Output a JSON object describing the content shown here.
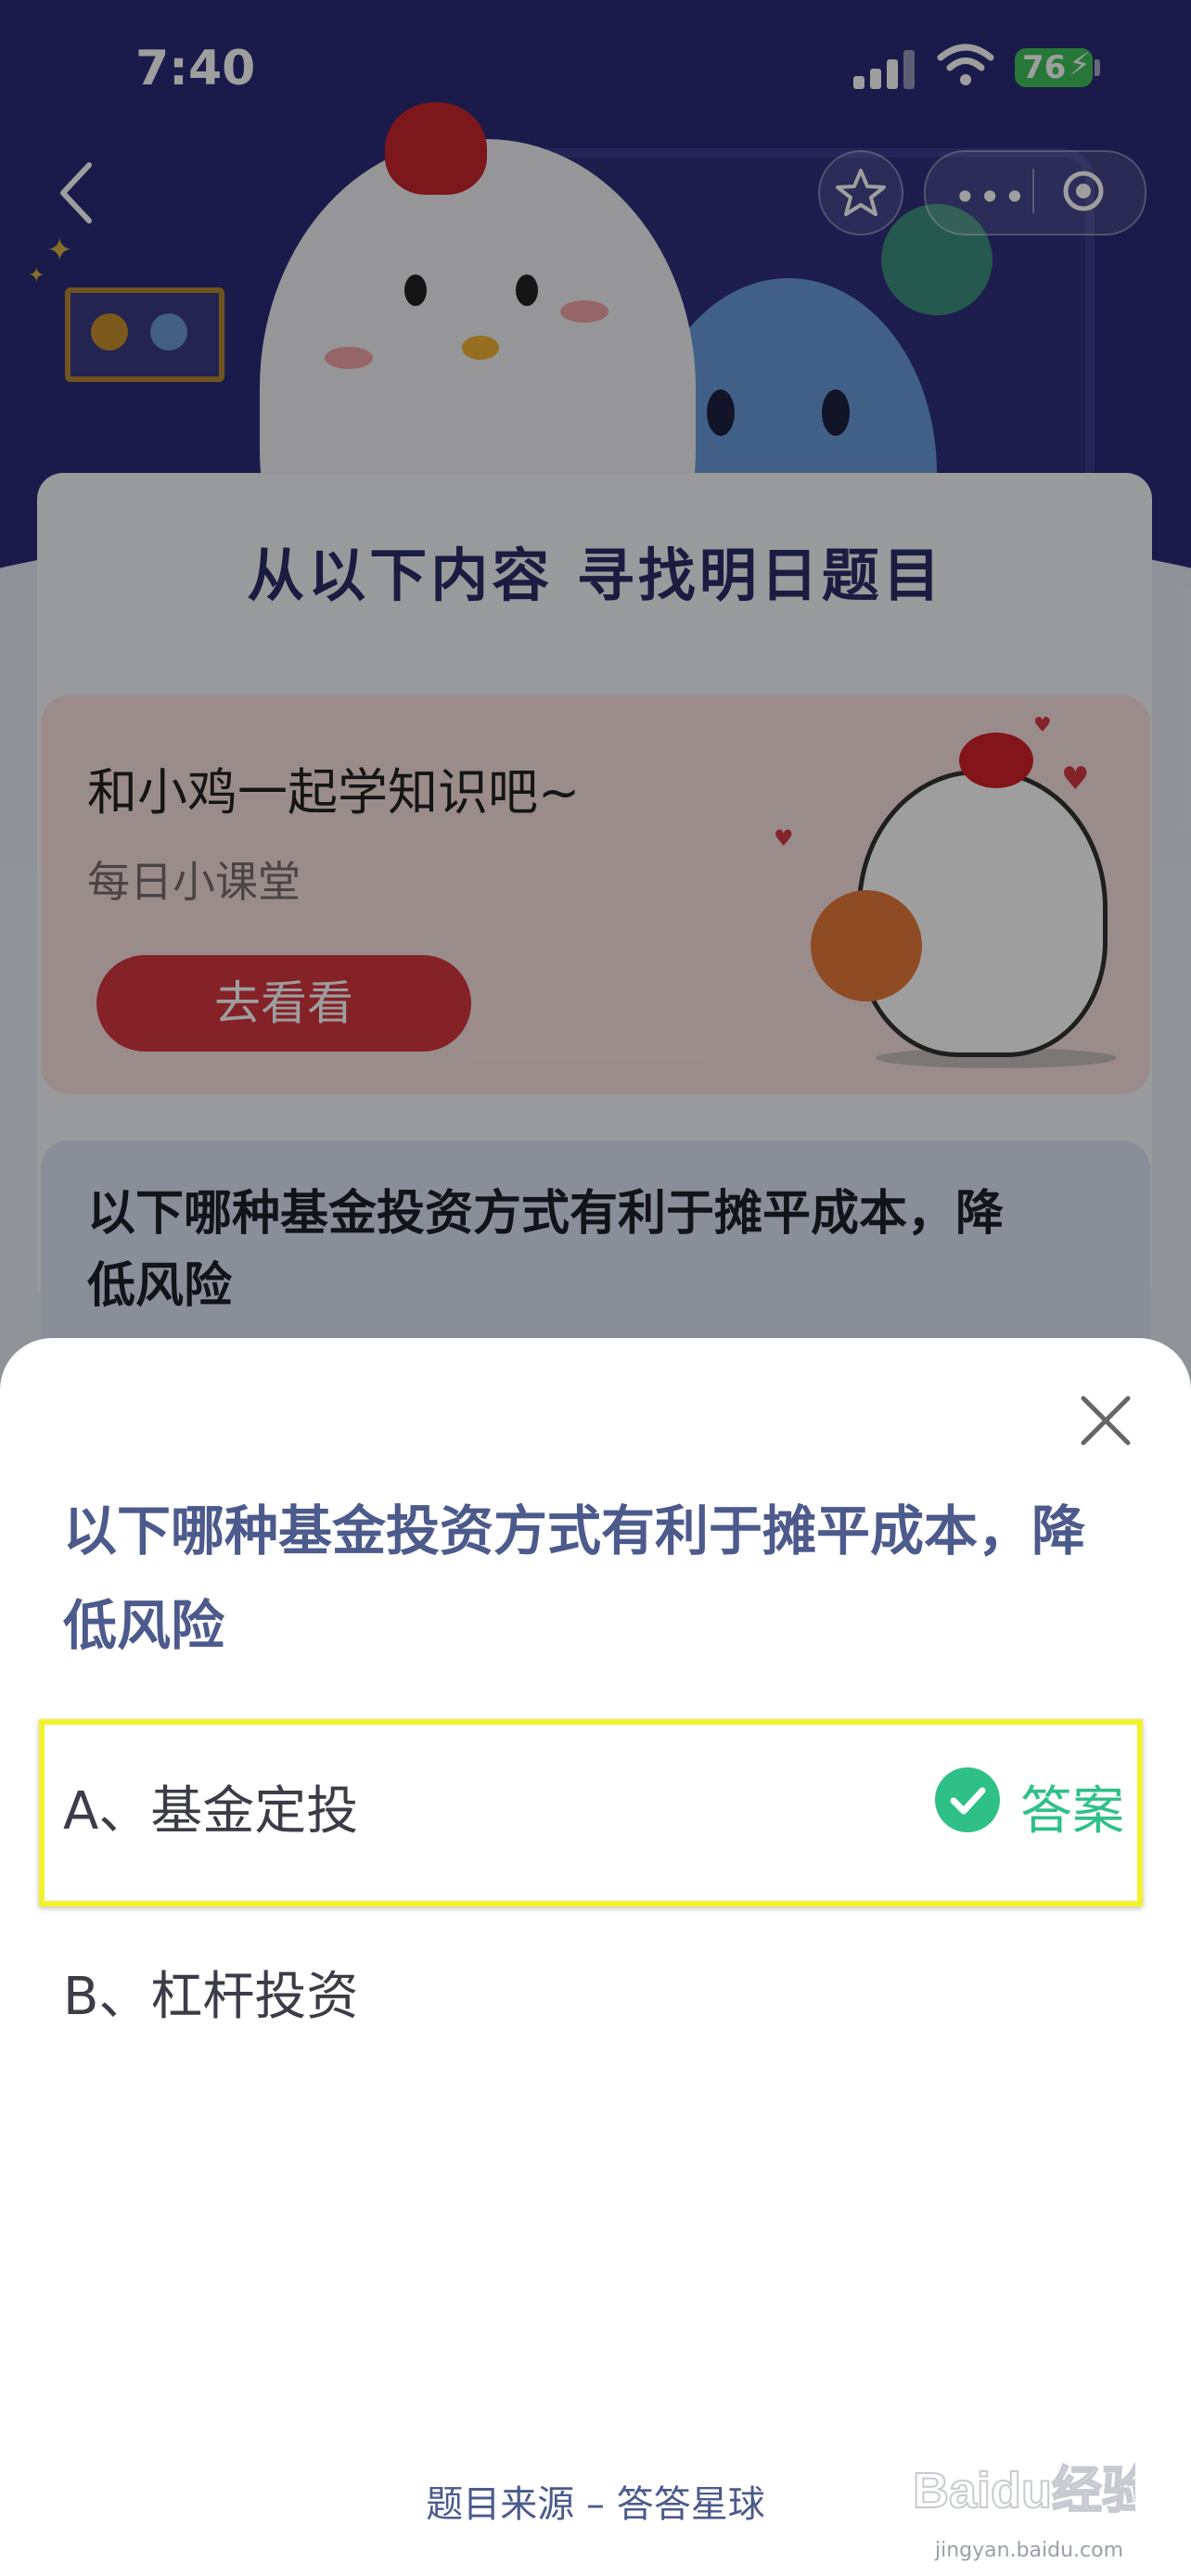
{
  "status_bar": {
    "time": "7:40",
    "battery": "76"
  },
  "hero": {
    "section_title": "从以下内容 寻找明日题目"
  },
  "promo": {
    "title": "和小鸡一起学知识吧~",
    "subtitle": "每日小课堂",
    "button": "去看看"
  },
  "question_card": {
    "text": "以下哪种基金投资方式有利于摊平成本，降低风险"
  },
  "sheet": {
    "question": "以下哪种基金投资方式有利于摊平成本，降低风险",
    "options": [
      {
        "label": "A、基金定投",
        "is_answer": true,
        "tag": "答案"
      },
      {
        "label": "B、杠杆投资",
        "is_answer": false
      }
    ],
    "source": "题目来源 – 答答星球"
  },
  "watermark": {
    "brand": "Baidu经验",
    "url": "jingyan.baidu.com"
  },
  "colors": {
    "accent_green": "#2ec087",
    "highlight_yellow": "#f2f22b",
    "question_text": "#4c5a8c",
    "hero_bg": "#2c2c79"
  }
}
